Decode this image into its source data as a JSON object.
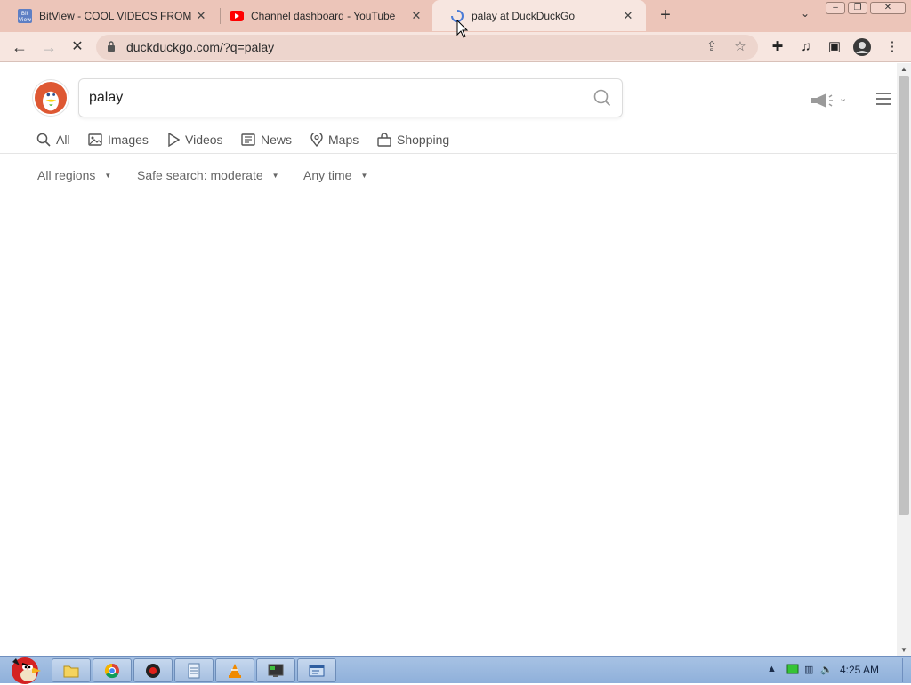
{
  "browser": {
    "tabs": [
      {
        "title": "BitView - COOL VIDEOS FROM",
        "icon": "bitview-icon",
        "active": false
      },
      {
        "title": "Channel dashboard - YouTube",
        "icon": "youtube-icon",
        "active": false
      },
      {
        "title": "palay at DuckDuckGo",
        "icon": "loading-spinner-icon",
        "active": true
      }
    ],
    "address": "duckduckgo.com/?q=palay",
    "colors": {
      "tabstrip": "#ecc5b9",
      "toolbar": "#f7e6e0",
      "omnibox": "#edd5cd"
    }
  },
  "search": {
    "query": "palay",
    "tabs": [
      "All",
      "Images",
      "Videos",
      "News",
      "Maps",
      "Shopping"
    ],
    "filters": [
      "All regions",
      "Safe search: moderate",
      "Any time"
    ],
    "brand_color": "#de5833"
  },
  "taskbar": {
    "clock": "4:25 AM",
    "apps": [
      "file-explorer-icon",
      "chrome-icon",
      "record-icon",
      "notepad-icon",
      "vlc-icon",
      "terminal-icon",
      "window-icon"
    ]
  }
}
